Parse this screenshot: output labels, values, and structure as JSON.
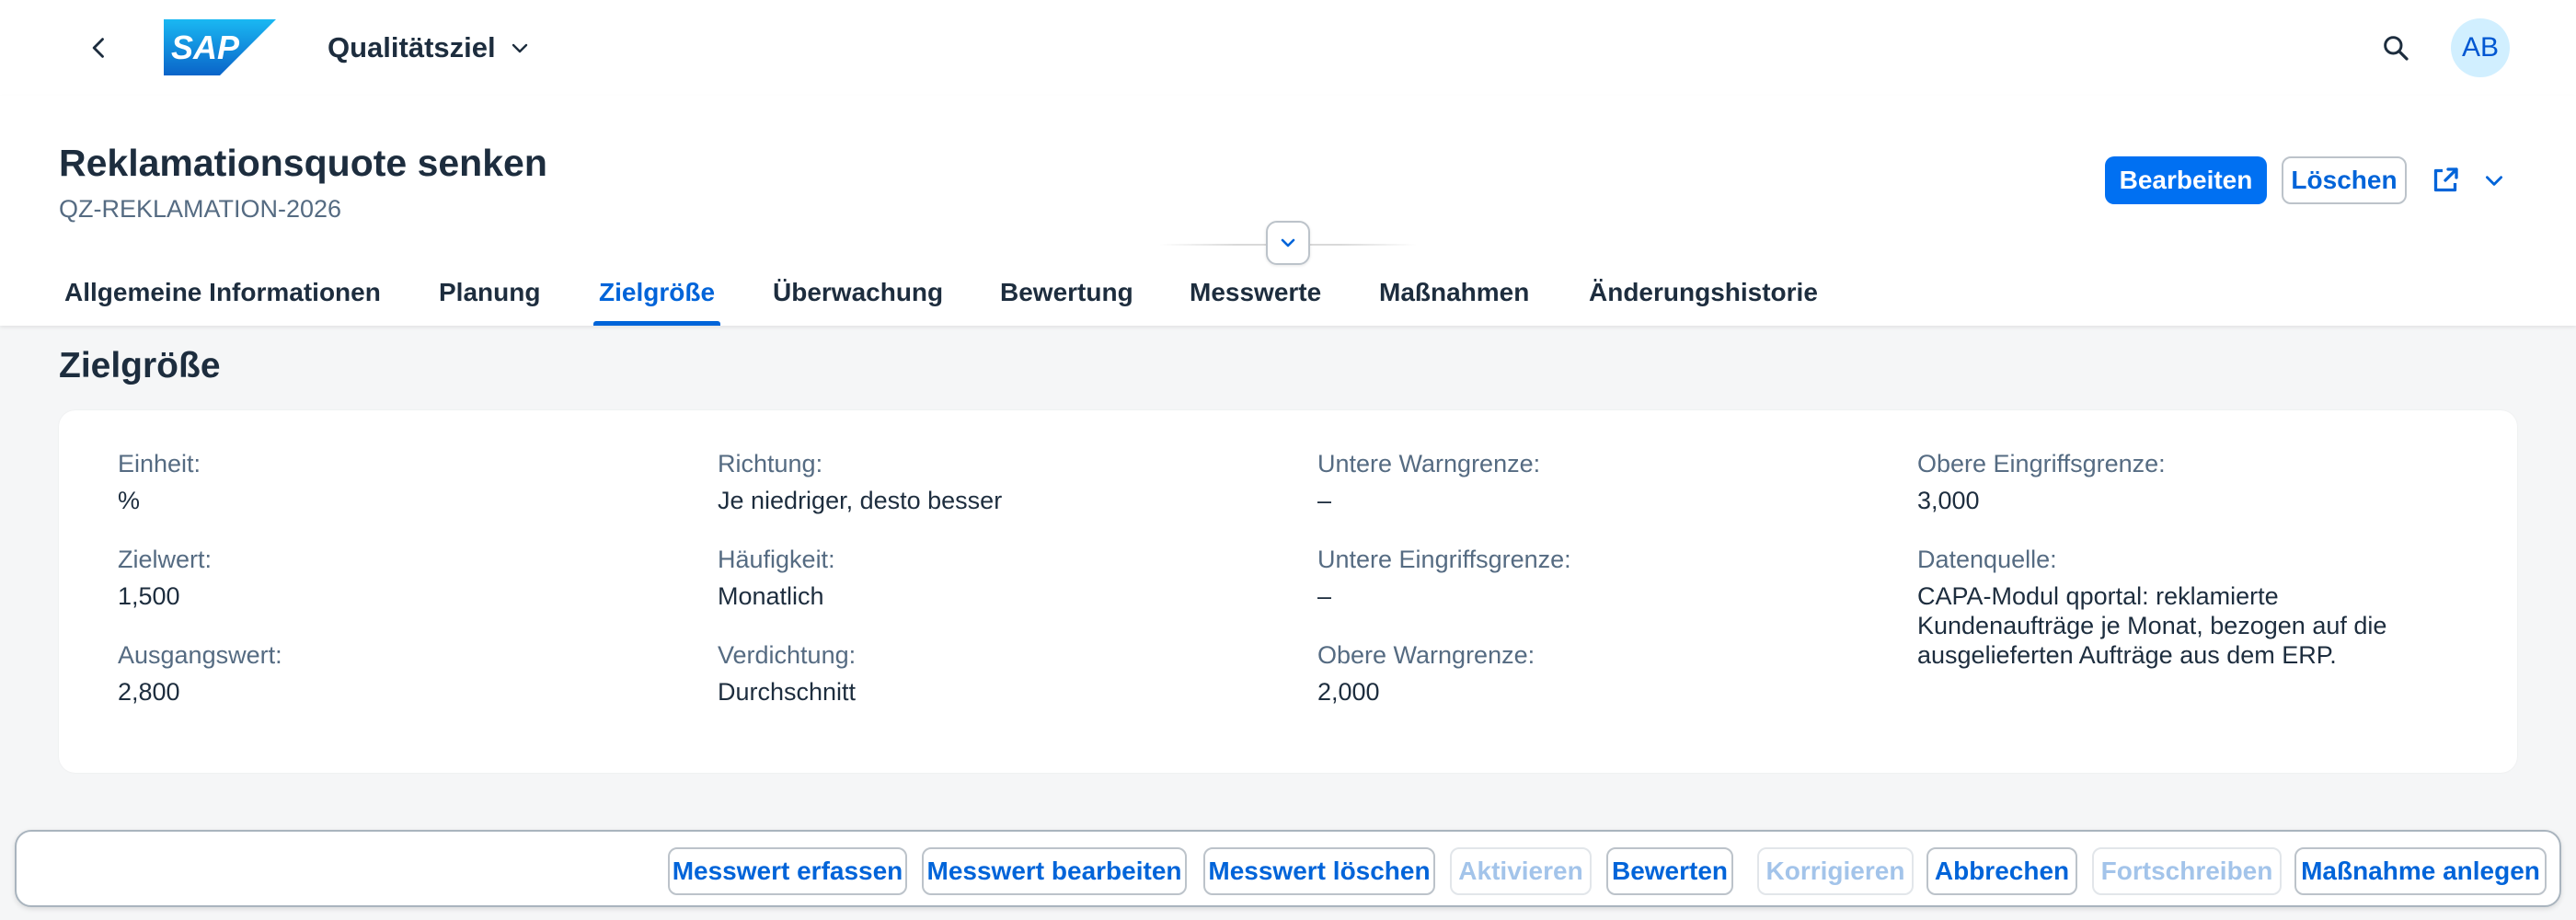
{
  "shell": {
    "app_title": "Qualitätsziel",
    "logo_text": "SAP",
    "avatar_initials": "AB",
    "icons": {
      "back": "chevron-left-icon",
      "search": "search-icon",
      "title_menu": "chevron-down-icon"
    }
  },
  "header": {
    "title": "Reklamationsquote senken",
    "subtitle": "QZ-REKLAMATION-2026",
    "edit_label": "Bearbeiten",
    "delete_label": "Löschen",
    "icons": {
      "share": "share-icon",
      "share_menu": "chevron-down-icon",
      "collapse": "chevron-down-icon"
    }
  },
  "tabs": [
    {
      "label": "Allgemeine Informationen",
      "active": false
    },
    {
      "label": "Planung",
      "active": false
    },
    {
      "label": "Zielgröße",
      "active": true
    },
    {
      "label": "Überwachung",
      "active": false
    },
    {
      "label": "Bewertung",
      "active": false
    },
    {
      "label": "Messwerte",
      "active": false
    },
    {
      "label": "Maßnahmen",
      "active": false
    },
    {
      "label": "Änderungshistorie",
      "active": false
    }
  ],
  "section": {
    "title": "Zielgröße",
    "fields": [
      {
        "label": "Einheit:",
        "value": "%"
      },
      {
        "label": "Zielwert:",
        "value": "1,500"
      },
      {
        "label": "Ausgangswert:",
        "value": "2,800"
      },
      {
        "label": "Richtung:",
        "value": "Je niedriger, desto besser"
      },
      {
        "label": "Häufigkeit:",
        "value": "Monatlich"
      },
      {
        "label": "Verdichtung:",
        "value": "Durchschnitt"
      },
      {
        "label": "Untere Warngrenze:",
        "value": "–"
      },
      {
        "label": "Untere Eingriffsgrenze:",
        "value": "–"
      },
      {
        "label": "Obere Warngrenze:",
        "value": "2,000"
      },
      {
        "label": "Obere Eingriffsgrenze:",
        "value": "3,000"
      },
      {
        "label": "Datenquelle:",
        "value": "CAPA-Modul qportal: reklamierte Kundenaufträge je Monat, bezogen auf die ausgelieferten Aufträge aus dem ERP."
      }
    ]
  },
  "footer": {
    "buttons": [
      {
        "label": "Messwert erfassen",
        "enabled": true
      },
      {
        "label": "Messwert bearbeiten",
        "enabled": true
      },
      {
        "label": "Messwert löschen",
        "enabled": true
      },
      {
        "label": "Aktivieren",
        "enabled": false
      },
      {
        "label": "Bewerten",
        "enabled": true
      },
      {
        "label": "Korrigieren",
        "enabled": false
      },
      {
        "label": "Abbrechen",
        "enabled": true
      },
      {
        "label": "Fortschreiben",
        "enabled": false
      },
      {
        "label": "Maßnahme anlegen",
        "enabled": true
      }
    ]
  },
  "colors": {
    "brand": "#0070f2",
    "link": "#0064d9",
    "text": "#1d2d3e",
    "label": "#556b82",
    "background": "#f5f6f7",
    "avatar_bg": "#d1efff",
    "disabled_text": "#a3c4ea"
  }
}
